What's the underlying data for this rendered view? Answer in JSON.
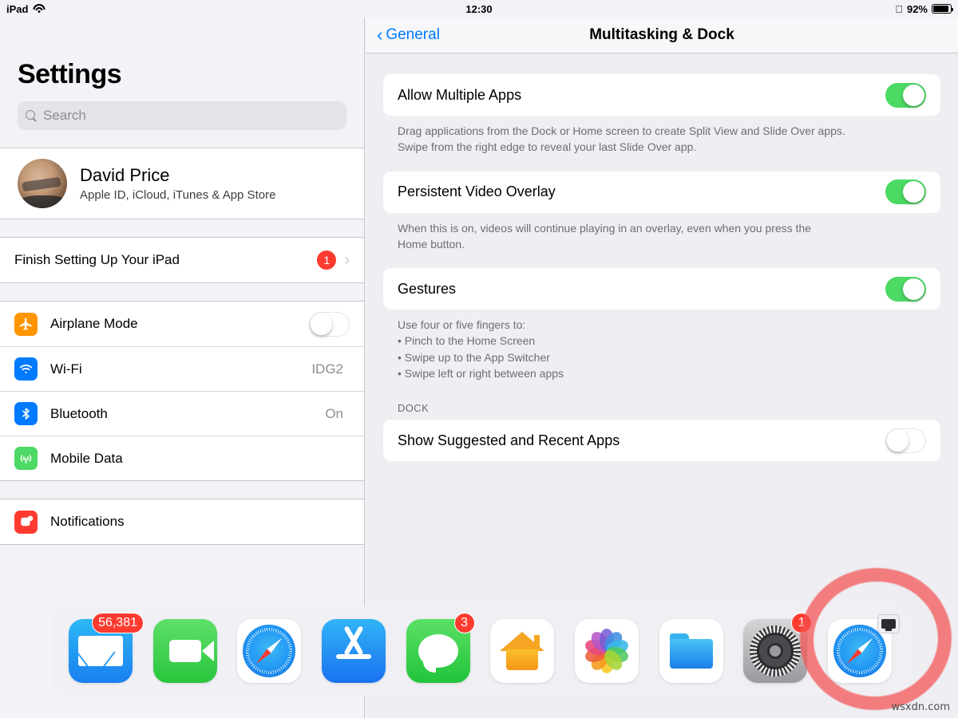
{
  "statusbar": {
    "device": "iPad",
    "wifi_icon": "wifi-icon",
    "time": "12:30",
    "bluetooth_icon": "bluetooth-icon",
    "battery_percent": "92%",
    "battery_level": 92
  },
  "sidebar": {
    "title": "Settings",
    "search": {
      "placeholder": "Search",
      "value": "",
      "icon": "search-icon"
    },
    "profile": {
      "name": "David Price",
      "subtitle": "Apple ID, iCloud, iTunes & App Store",
      "avatar": "avatar"
    },
    "setup_row": {
      "label": "Finish Setting Up Your iPad",
      "badge": "1",
      "chevron": "chevron-right-icon"
    },
    "connectivity": [
      {
        "label": "Airplane Mode",
        "icon": "airplane-icon",
        "icon_color": "#ff9500",
        "control": "toggle",
        "toggle_on": false
      },
      {
        "label": "Wi-Fi",
        "icon": "wifi-icon",
        "icon_color": "#007aff",
        "control": "value",
        "value": "IDG2"
      },
      {
        "label": "Bluetooth",
        "icon": "bluetooth-icon",
        "icon_color": "#007aff",
        "control": "value",
        "value": "On"
      },
      {
        "label": "Mobile Data",
        "icon": "cellular-icon",
        "icon_color": "#4cd964",
        "control": "value",
        "value": ""
      }
    ],
    "next_section": [
      {
        "label": "Notifications",
        "icon": "notifications-icon",
        "icon_color": "#ff3b30"
      }
    ]
  },
  "detail": {
    "back_label": "General",
    "back_icon": "chevron-left-icon",
    "title": "Multitasking & Dock",
    "rows": [
      {
        "label": "Allow Multiple Apps",
        "toggle_on": true,
        "footnote_lines": [
          "Drag applications from the Dock or Home screen to create Split View and Slide Over apps.",
          "Swipe from the right edge to reveal your last Slide Over app."
        ]
      },
      {
        "label": "Persistent Video Overlay",
        "toggle_on": true,
        "footnote_lines": [
          "When this is on, videos will continue playing in an overlay, even when you press the",
          "Home button."
        ]
      },
      {
        "label": "Gestures",
        "toggle_on": true,
        "footnote_lines": [
          "Use four or five fingers to:",
          "• Pinch to the Home Screen",
          "• Swipe up to the App Switcher",
          "• Swipe left or right between apps"
        ]
      }
    ],
    "dock_section": {
      "header": "DOCK",
      "row": {
        "label": "Show Suggested and Recent Apps",
        "toggle_on": false
      }
    }
  },
  "dock": {
    "apps": [
      {
        "name": "Mail",
        "icon": "mail-icon",
        "badge": "56,381"
      },
      {
        "name": "FaceTime",
        "icon": "facetime-icon",
        "badge": ""
      },
      {
        "name": "Safari",
        "icon": "safari-icon",
        "badge": ""
      },
      {
        "name": "App Store",
        "icon": "app-store-icon",
        "badge": ""
      },
      {
        "name": "Messages",
        "icon": "messages-icon",
        "badge": "3"
      },
      {
        "name": "Home",
        "icon": "home-icon",
        "badge": ""
      },
      {
        "name": "Photos",
        "icon": "photos-icon",
        "badge": ""
      },
      {
        "name": "Files",
        "icon": "files-icon",
        "badge": ""
      },
      {
        "name": "Settings",
        "icon": "settings-gear-icon",
        "badge": "1"
      },
      {
        "name": "Safari Handoff",
        "icon": "safari-icon",
        "badge": "",
        "handoff": true
      }
    ]
  },
  "annotation": {
    "shape": "red-circle-highlight",
    "color": "#f45050"
  },
  "watermark": "wsxdn.com",
  "colors": {
    "accent_blue": "#007aff",
    "toggle_green": "#4cd964",
    "badge_red": "#ff3b30",
    "sidebar_bg": "#f2f2f7",
    "detail_bg": "#eeeef3"
  }
}
